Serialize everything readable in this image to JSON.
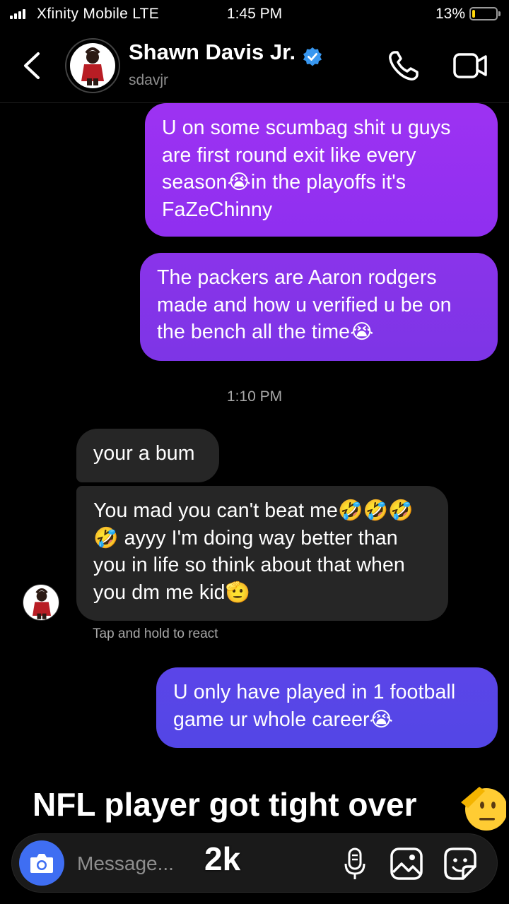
{
  "status_bar": {
    "carrier": "Xfinity Mobile  LTE",
    "time": "1:45 PM",
    "battery_percent": "13%",
    "battery_level": 0.13
  },
  "header": {
    "contact_name": "Shawn Davis Jr.",
    "username": "sdavjr",
    "verified": true,
    "icons": [
      "back-arrow-icon",
      "avatar",
      "verified-badge-icon",
      "phone-icon",
      "video-camera-icon"
    ]
  },
  "messages": {
    "sent_1": "U on some scumbag shit u guys are first round exit like every season😭in the playoffs it's FaZeChinny",
    "sent_2": "The packers are Aaron rodgers made and how u verified u be on the bench all the time😭",
    "timestamp": "1:10 PM",
    "received_1": "your a bum",
    "received_2": "You mad you can't beat me🤣🤣🤣🤣 ayyy I'm doing way better than you in life so think about that when you dm me kid🫡",
    "react_hint": "Tap and hold to react",
    "sent_3": "U only have played in 1 football game ur whole career😭"
  },
  "overlay": {
    "caption": "NFL player got tight over",
    "count": "2k"
  },
  "composer": {
    "placeholder": "Message...",
    "icons": [
      "camera-icon",
      "microphone-icon",
      "gallery-icon",
      "sticker-icon"
    ]
  },
  "colors": {
    "sent_top": "#9d32f2",
    "sent_mid": "#7d35e6",
    "sent_bottom": "#5346e6",
    "received": "#262626",
    "camera_button": "#3f6ef2",
    "verified": "#3897f0"
  }
}
